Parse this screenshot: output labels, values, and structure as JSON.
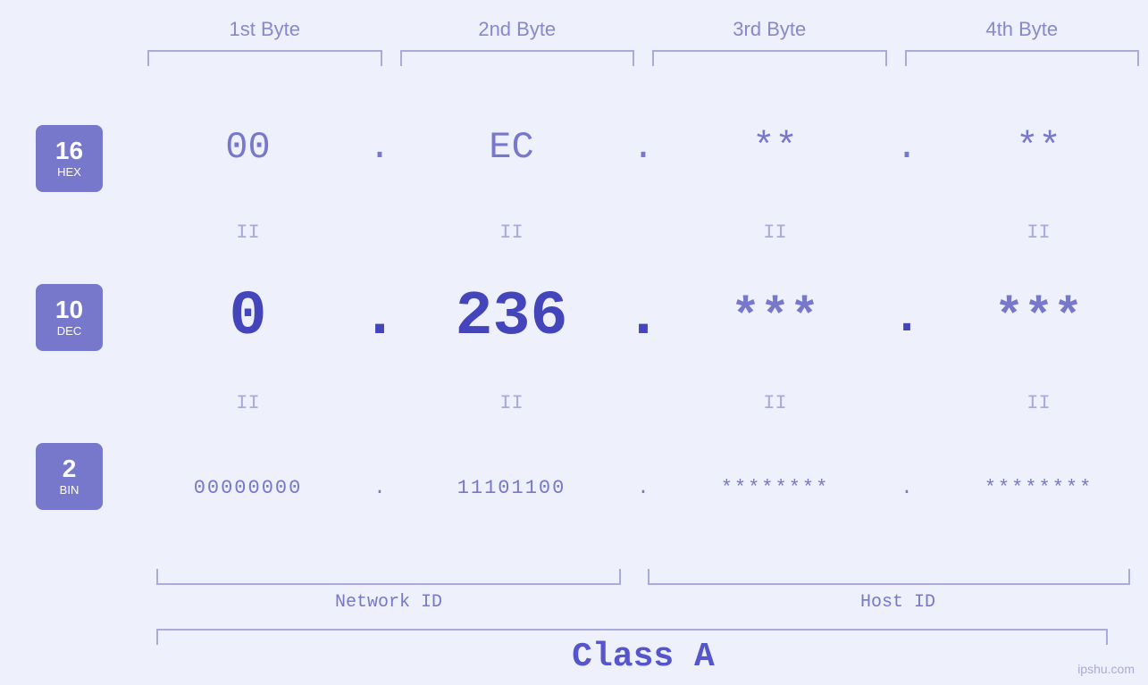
{
  "bytes": {
    "headers": [
      "1st Byte",
      "2nd Byte",
      "3rd Byte",
      "4th Byte"
    ]
  },
  "badges": [
    {
      "number": "16",
      "label": "HEX"
    },
    {
      "number": "10",
      "label": "DEC"
    },
    {
      "number": "2",
      "label": "BIN"
    }
  ],
  "hex_row": {
    "values": [
      "00",
      "EC",
      "**",
      "**"
    ],
    "dots": [
      ".",
      ".",
      ".",
      ""
    ]
  },
  "dec_row": {
    "values": [
      "0",
      "236",
      "***",
      "***"
    ],
    "dots": [
      ".",
      ".",
      ".",
      ""
    ]
  },
  "bin_row": {
    "values": [
      "00000000",
      "11101100",
      "********",
      "********"
    ],
    "dots": [
      ".",
      ".",
      ".",
      ""
    ]
  },
  "labels": {
    "network_id": "Network ID",
    "host_id": "Host ID",
    "class": "Class A"
  },
  "watermark": "ipshu.com"
}
